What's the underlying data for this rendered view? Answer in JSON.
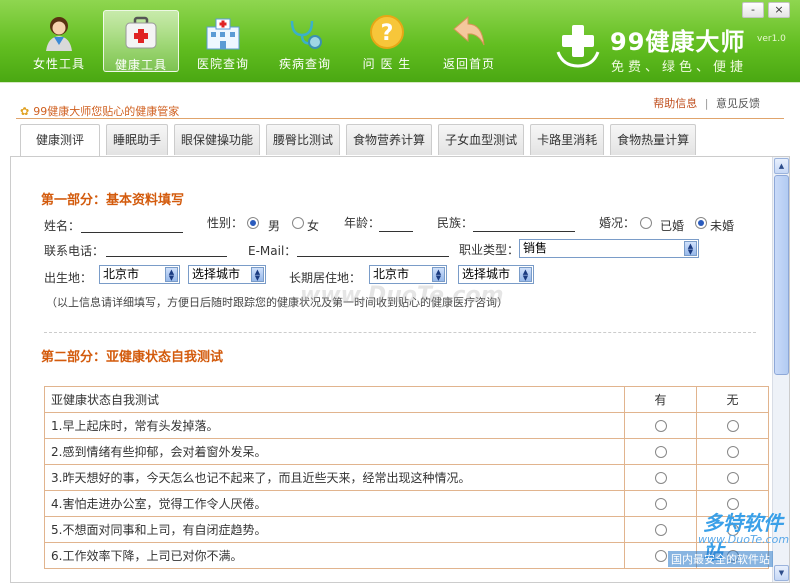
{
  "window": {
    "minimize_label": "-",
    "close_label": "×"
  },
  "nav": [
    {
      "label": "女性工具",
      "icon": "woman-icon"
    },
    {
      "label": "健康工具",
      "icon": "medical-kit-icon",
      "active": true
    },
    {
      "label": "医院查询",
      "icon": "hospital-icon"
    },
    {
      "label": "疾病查询",
      "icon": "stethoscope-icon"
    },
    {
      "label": "问 医 生",
      "icon": "question-icon"
    },
    {
      "label": "返回首页",
      "icon": "back-arrow-icon"
    }
  ],
  "brand": {
    "title": "99健康大师",
    "version": "ver1.0",
    "slogan": "免费、绿色、便捷"
  },
  "subbar": {
    "tagline": "99健康大师您贴心的健康管家",
    "help": "帮助信息",
    "divider": "|",
    "feedback": "意见反馈"
  },
  "tabs": [
    "健康测评",
    "睡眠助手",
    "眼保健操功能",
    "腰臀比测试",
    "食物营养计算",
    "子女血型测试",
    "卡路里消耗",
    "食物热量计算"
  ],
  "part1": {
    "title": "第一部分：基本资料填写",
    "name_label": "姓名：",
    "gender_label": "性别：",
    "male": "男",
    "female": "女",
    "age_label": "年龄：",
    "ethnicity_label": "民族：",
    "marital_label": "婚况：",
    "married": "已婚",
    "unmarried": "未婚",
    "phone_label": "联系电话：",
    "email_label": "E-Mail：",
    "job_label": "职业类型：",
    "job_value": "销售",
    "birthplace_label": "出生地：",
    "birth_province": "北京市",
    "birth_city": "选择城市",
    "residence_label": "长期居住地：",
    "res_province": "北京市",
    "res_city": "选择城市",
    "note": "（以上信息请详细填写，方便日后随时跟踪您的健康状况及第一时间收到贴心的健康医疗咨询）"
  },
  "part2": {
    "title": "第二部分：亚健康状态自我测试",
    "header": {
      "question": "亚健康状态自我测试",
      "yes": "有",
      "no": "无"
    },
    "questions": [
      "1.早上起床时，常有头发掉落。",
      "2.感到情绪有些抑郁，会对着窗外发呆。",
      "3.昨天想好的事，今天怎么也记不起来了，而且近些天来，经常出现这种情况。",
      "4.害怕走进办公室，觉得工作令人厌倦。",
      "5.不想面对同事和上司，有自闭症趋势。",
      "6.工作效率下降，上司已对你不满。"
    ]
  },
  "watermark": {
    "center": "www.DuoTe.com",
    "logo_a": "多特软件站",
    "logo_b": "www.DuoTe.com",
    "logo_c": "国内最安全的软件站"
  }
}
